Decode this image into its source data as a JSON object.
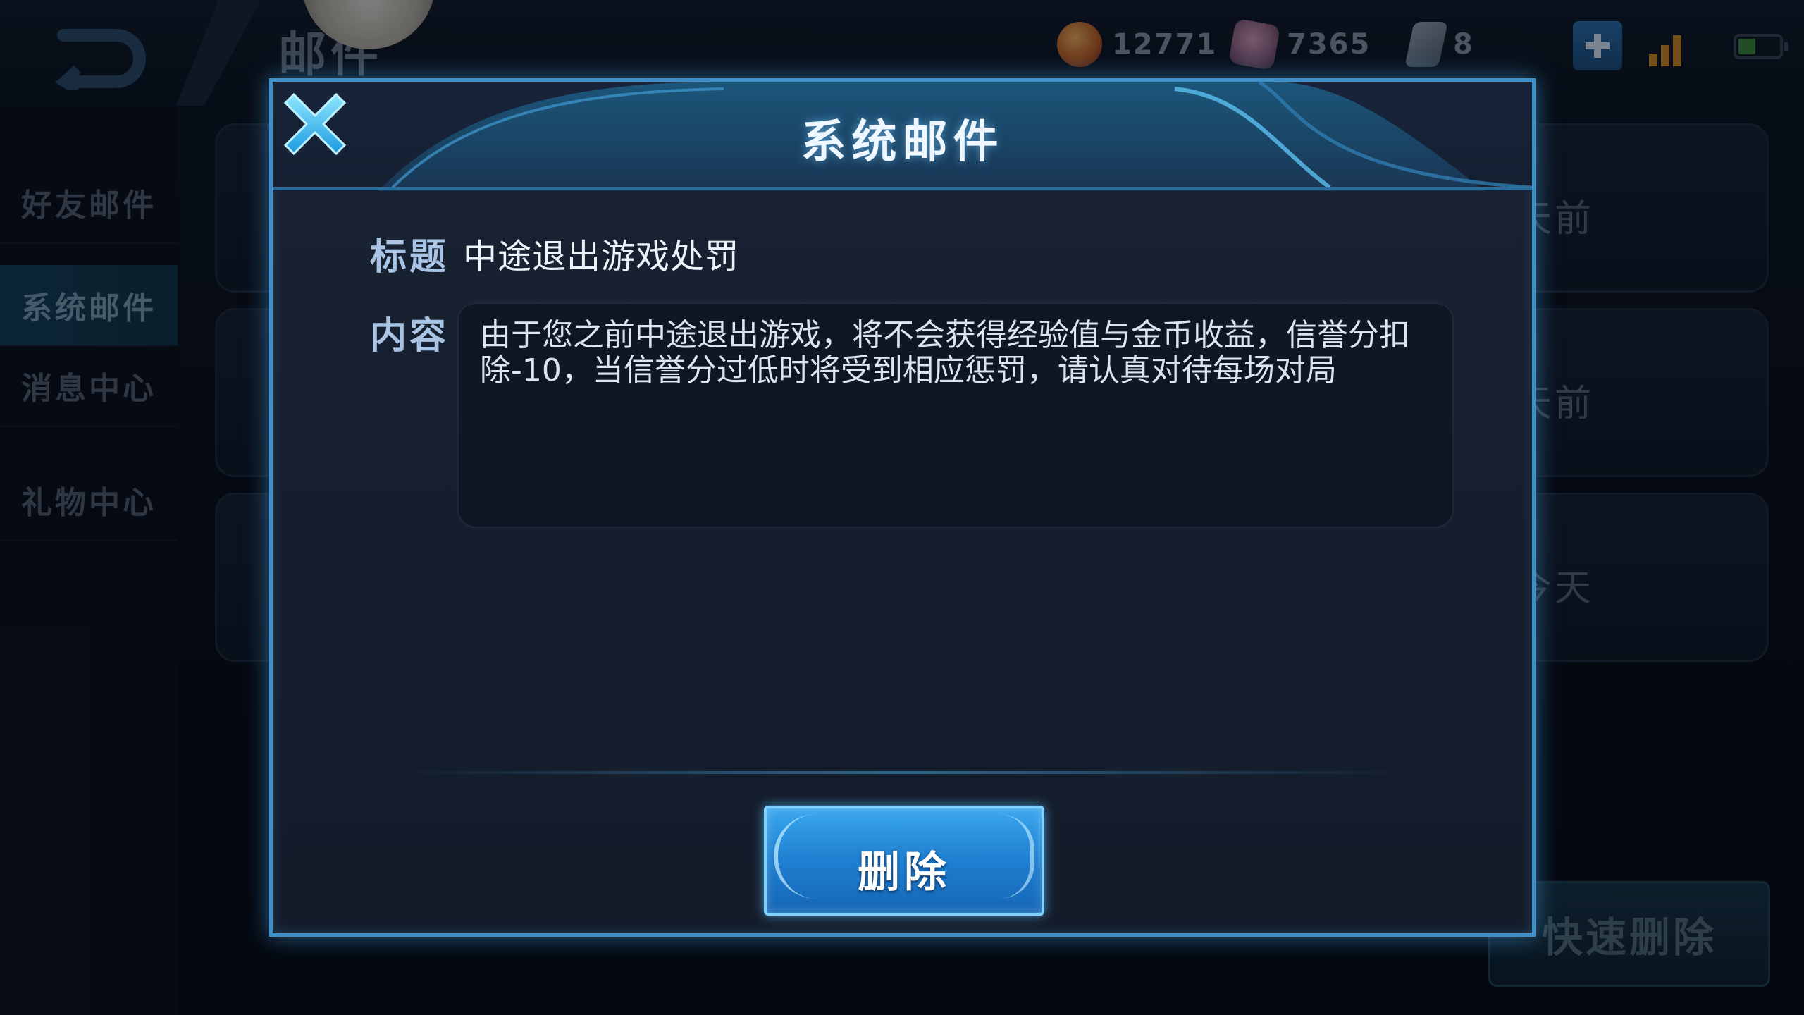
{
  "header": {
    "page_title": "邮件",
    "currencies": [
      {
        "icon": "coin-icon",
        "value": "12771"
      },
      {
        "icon": "gem-icon",
        "value": "7365"
      },
      {
        "icon": "ticket-icon",
        "value": "8"
      }
    ]
  },
  "sidebar": {
    "items": [
      {
        "label": "好友邮件",
        "active": false
      },
      {
        "label": "系统邮件",
        "active": true
      },
      {
        "label": "消息中心",
        "active": false
      },
      {
        "label": "礼物中心",
        "active": false
      }
    ]
  },
  "mail_list": {
    "times": [
      "天前",
      "天前",
      "今天"
    ],
    "quick_delete_label": "快速删除"
  },
  "dialog": {
    "title": "系统邮件",
    "subject_label": "标题",
    "subject": "中途退出游戏处罚",
    "content_label": "内容",
    "content": "由于您之前中途退出游戏，将不会获得经验值与金币收益，信誉分扣除-10，当信誉分过低时将受到相应惩罚，请认真对待每场对局",
    "delete_label": "删除"
  },
  "colors": {
    "accent": "#3c8fc8",
    "button": "#1f7fd0",
    "close": "#3fc6ff"
  }
}
